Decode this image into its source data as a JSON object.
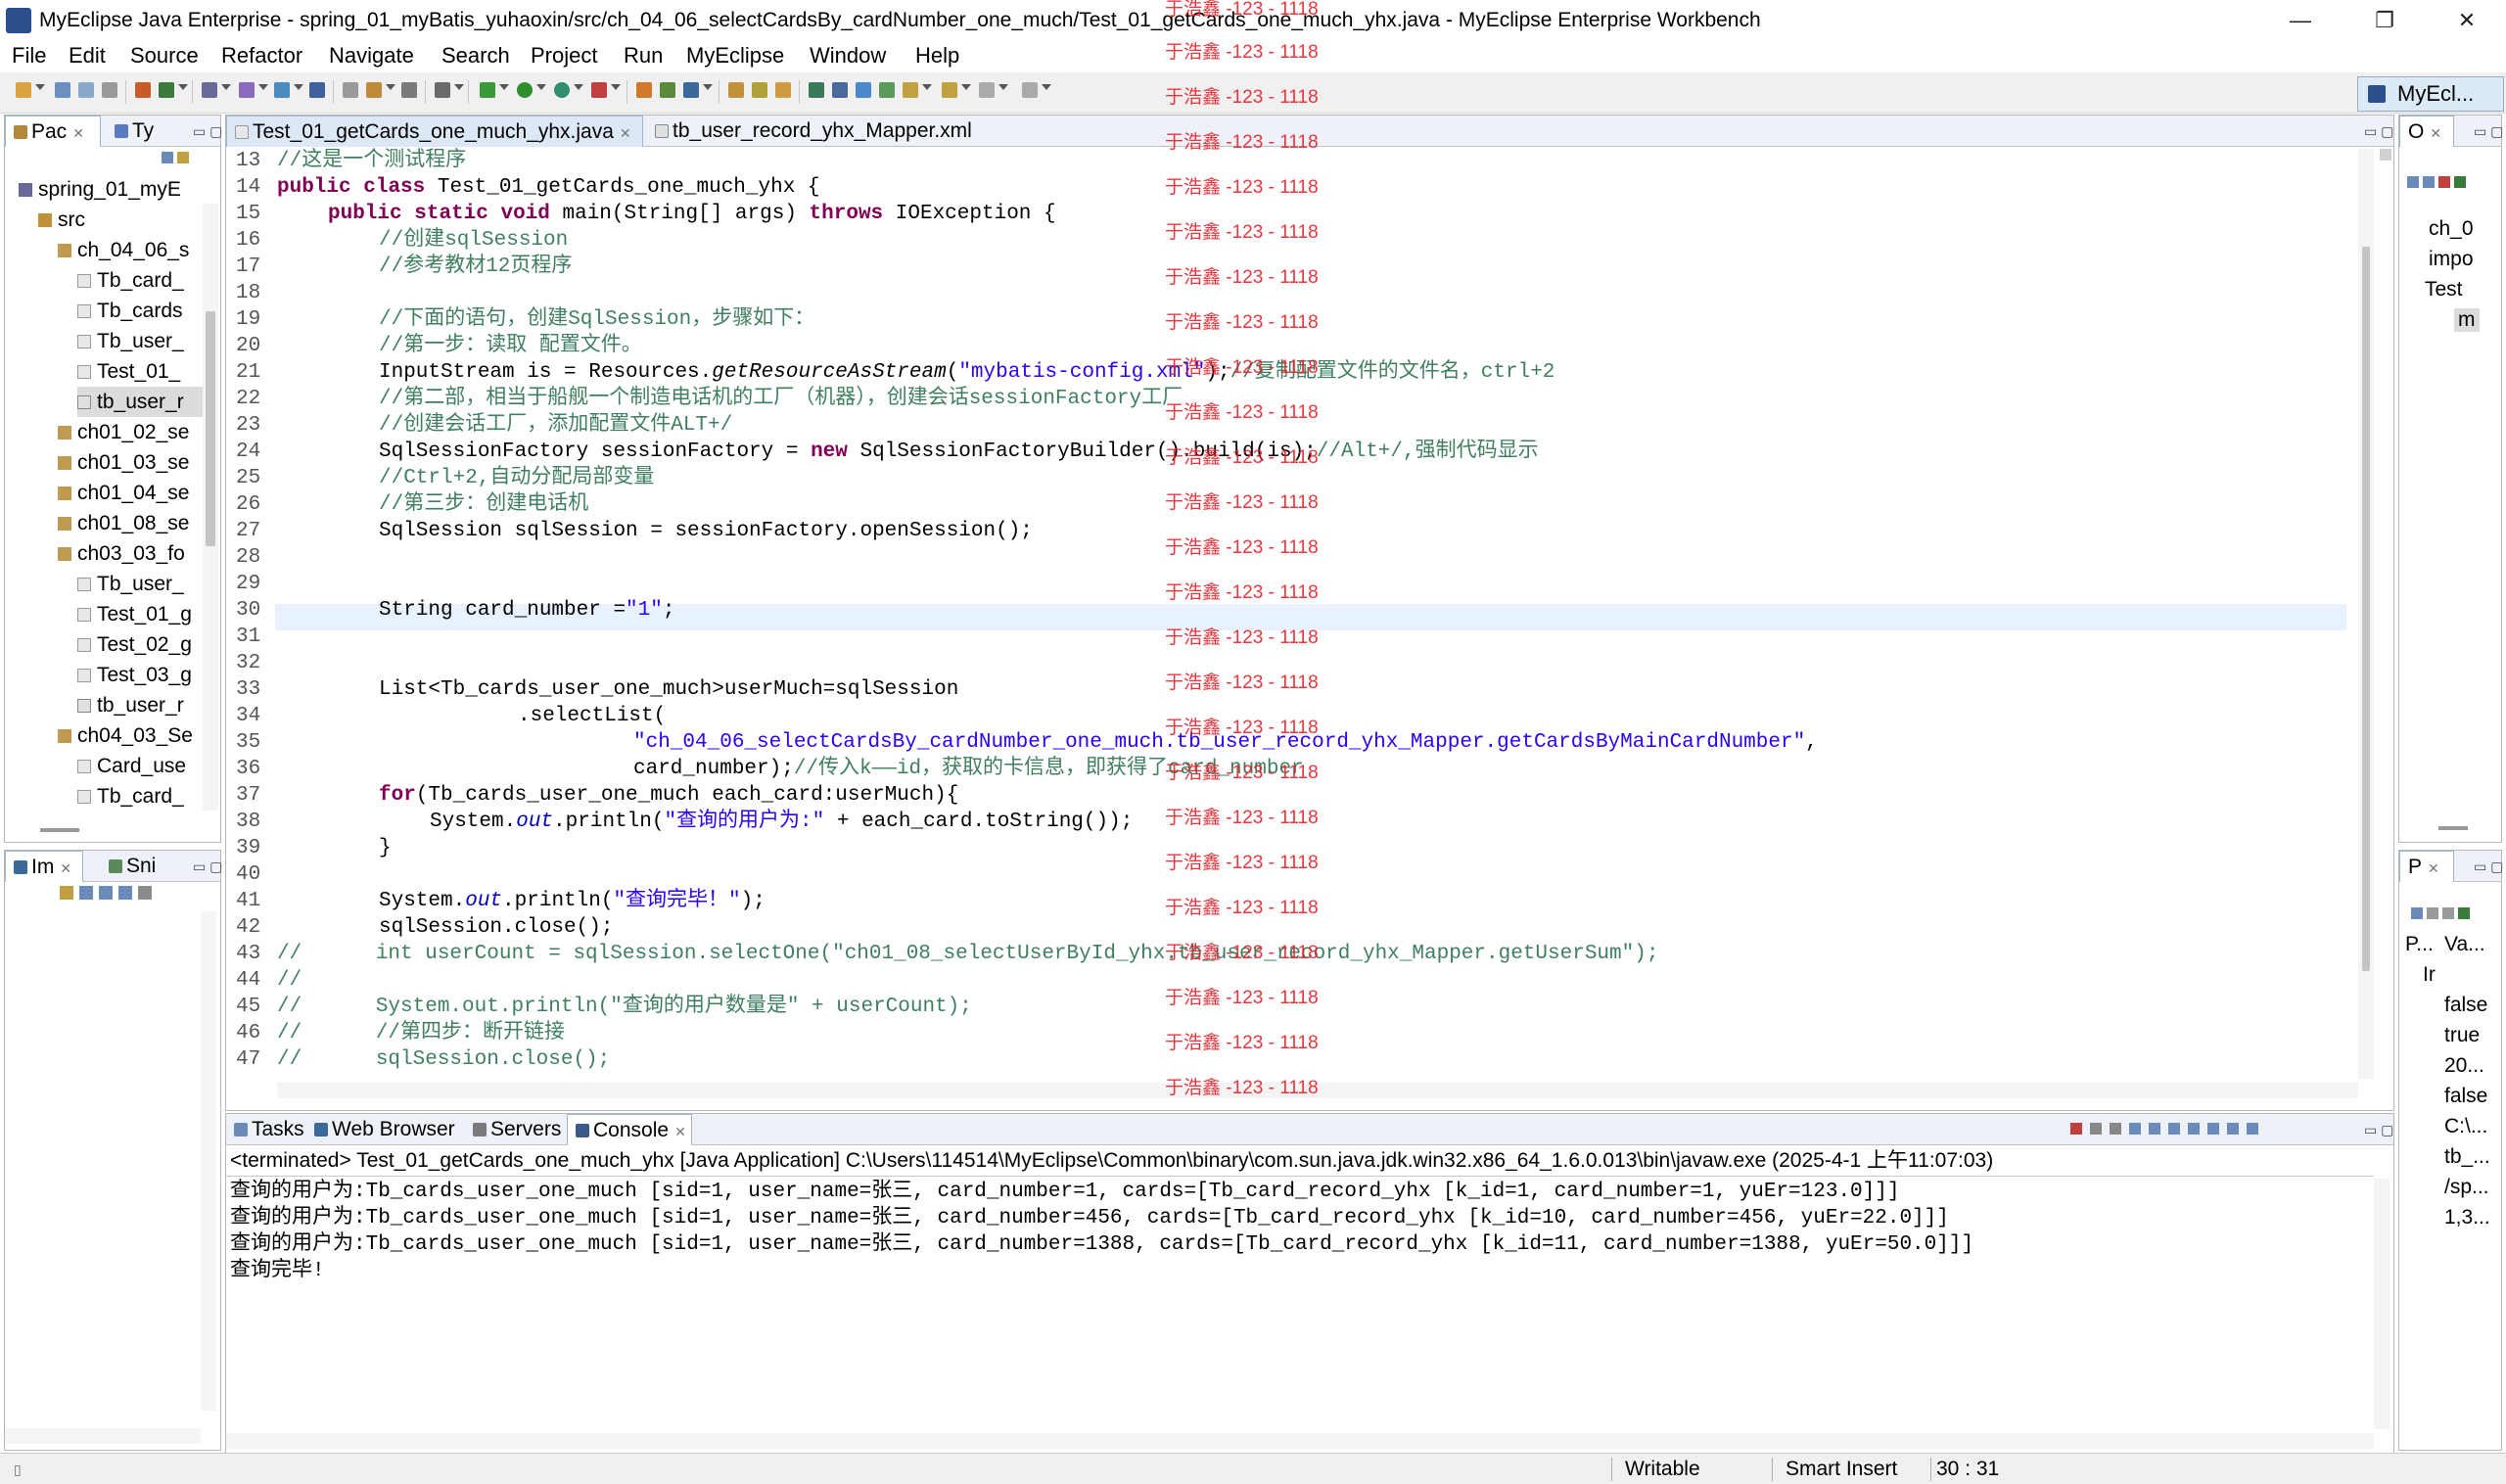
{
  "window": {
    "title": "MyEclipse Java Enterprise - spring_01_myBatis_yuhaoxin/src/ch_04_06_selectCardsBy_cardNumber_one_much/Test_01_getCards_one_much_yhx.java - MyEclipse Enterprise Workbench",
    "minimize": "—",
    "maximize": "❐",
    "close": "✕"
  },
  "menu": [
    "File",
    "Edit",
    "Source",
    "Refactor",
    "Navigate",
    "Search",
    "Project",
    "Run",
    "MyEclipse",
    "Window",
    "Help"
  ],
  "perspective": {
    "label": "MyEcl..."
  },
  "package_explorer": {
    "tabs": [
      "Pac",
      "Ty"
    ],
    "tree": [
      {
        "label": "spring_01_myE",
        "type": "project"
      },
      {
        "label": "src",
        "type": "folder"
      },
      {
        "label": "ch_04_06_s",
        "type": "package"
      },
      {
        "label": "Tb_card_",
        "type": "java"
      },
      {
        "label": "Tb_cards",
        "type": "java"
      },
      {
        "label": "Tb_user_",
        "type": "java"
      },
      {
        "label": "Test_01_",
        "type": "java"
      },
      {
        "label": "tb_user_r",
        "type": "xml",
        "selected": true
      },
      {
        "label": "ch01_02_se",
        "type": "package"
      },
      {
        "label": "ch01_03_se",
        "type": "package"
      },
      {
        "label": "ch01_04_se",
        "type": "package"
      },
      {
        "label": "ch01_08_se",
        "type": "package"
      },
      {
        "label": "ch03_03_fo",
        "type": "package"
      },
      {
        "label": "Tb_user_",
        "type": "java"
      },
      {
        "label": "Test_01_g",
        "type": "java"
      },
      {
        "label": "Test_02_g",
        "type": "java"
      },
      {
        "label": "Test_03_g",
        "type": "java"
      },
      {
        "label": "tb_user_r",
        "type": "xml"
      },
      {
        "label": "ch04_03_Se",
        "type": "package"
      },
      {
        "label": "Card_use",
        "type": "java"
      },
      {
        "label": "Tb_card_",
        "type": "java"
      }
    ]
  },
  "hierarchy_panel": {
    "tabs": [
      "Im",
      "Sni"
    ]
  },
  "editor": {
    "tabs": [
      "Test_01_getCards_one_much_yhx.java",
      "tb_user_record_yhx_Mapper.xml"
    ],
    "line_numbers": [
      "13",
      "14",
      "15",
      "16",
      "17",
      "18",
      "19",
      "20",
      "21",
      "22",
      "23",
      "24",
      "25",
      "26",
      "27",
      "28",
      "29",
      "30",
      "31",
      "32",
      "33",
      "34",
      "35",
      "36",
      "37",
      "38",
      "39",
      "40",
      "41",
      "42",
      "43",
      "44",
      "45",
      "46",
      "47"
    ],
    "lines": {
      "l13": "//这是一个测试程序",
      "l14_kw1": "public",
      "l14_kw2": "class",
      "l14_rest": " Test_01_getCards_one_much_yhx {",
      "l15_kw1": "public",
      "l15_kw2": "static",
      "l15_kw3": "void",
      "l15_mid": " main(String[] args) ",
      "l15_kw4": "throws",
      "l15_rest": " IOException {",
      "l16": "//创建sqlSession",
      "l17": "//参考教材12页程序",
      "l19": "//下面的语句，创建SqlSession，步骤如下：",
      "l20": "//第一步：读取 配置文件。",
      "l21_a": "InputStream is = Resources.",
      "l21_m": "getResourceAsStream",
      "l21_b": "(",
      "l21_s": "\"mybatis-config.xml\"",
      "l21_c": ");",
      "l21_cm": "//复制配置文件的文件名，ctrl+2",
      "l22": "//第二部，相当于船舰一个制造电话机的工厂（机器），创建会话sessionFactory工厂",
      "l23": "//创建会话工厂，添加配置文件ALT+/",
      "l24_a": "SqlSessionFactory sessionFactory = ",
      "l24_kw": "new",
      "l24_b": " SqlSessionFactoryBuilder().build(is);",
      "l24_cm": "//Alt+/,强制代码显示",
      "l25": "//Ctrl+2,自动分配局部变量",
      "l26": "//第三步：创建电话机",
      "l27": "SqlSession sqlSession = sessionFactory.openSession();",
      "l30_a": "String card_number =",
      "l30_s": "\"1\"",
      "l30_b": ";",
      "l33": "List<Tb_cards_user_one_much>userMuch=sqlSession",
      "l34": ".selectList(",
      "l35_s": "\"ch_04_06_selectCardsBy_cardNumber_one_much.tb_user_record_yhx_Mapper.getCardsByMainCardNumber\"",
      "l35_b": ",",
      "l36_a": "card_number);",
      "l36_cm": "//传入k——id，获取的卡信息，即获得了card_number",
      "l37_kw": "for",
      "l37_b": "(Tb_cards_user_one_much each_card:userMuch){",
      "l38_a": "System.",
      "l38_f": "out",
      "l38_b": ".println(",
      "l38_s": "\"查询的用户为:\"",
      "l38_c": " + each_card.toString());",
      "l39": "}",
      "l41_a": "System.",
      "l41_f": "out",
      "l41_b": ".println(",
      "l41_s": "\"查询完毕！\"",
      "l41_c": ");",
      "l42": "sqlSession.close();",
      "l43": "//      int userCount = sqlSession.selectOne(\"ch01_08_selectUserById_yhx.tb_user_record_yhx_Mapper.getUserSum\");",
      "l44": "//",
      "l45": "//      System.out.println(\"查询的用户数量是\" + userCount);",
      "l46": "//      //第四步：断开链接",
      "l47": "//      sqlSession.close();"
    },
    "watermark": "于浩鑫 -123 - 1118"
  },
  "outline_panel": {
    "tabs": [
      "O"
    ],
    "items": [
      "ch_0",
      "impo",
      "Test",
      "m"
    ]
  },
  "properties_panel": {
    "tabs": [
      "P"
    ],
    "headers": [
      "P...",
      "Va..."
    ],
    "values": [
      "Ir",
      "false",
      "true",
      "20...",
      "false",
      "C:\\...",
      "tb_...",
      "/sp...",
      "1,3..."
    ]
  },
  "console": {
    "tabs": [
      "Tasks",
      "Web Browser",
      "Servers",
      "Console"
    ],
    "header": "<terminated> Test_01_getCards_one_much_yhx [Java Application] C:\\Users\\114514\\MyEclipse\\Common\\binary\\com.sun.java.jdk.win32.x86_64_1.6.0.013\\bin\\javaw.exe (2025-4-1 上午11:07:03)",
    "lines": [
      "查询的用户为:Tb_cards_user_one_much [sid=1, user_name=张三, card_number=1, cards=[Tb_card_record_yhx [k_id=1, card_number=1, yuEr=123.0]]]",
      "查询的用户为:Tb_cards_user_one_much [sid=1, user_name=张三, card_number=456, cards=[Tb_card_record_yhx [k_id=10, card_number=456, yuEr=22.0]]]",
      "查询的用户为:Tb_cards_user_one_much [sid=1, user_name=张三, card_number=1388, cards=[Tb_card_record_yhx [k_id=11, card_number=1388, yuEr=50.0]]]",
      "查询完毕!"
    ]
  },
  "status": {
    "writable": "Writable",
    "insert": "Smart Insert",
    "position": "30 : 31"
  }
}
